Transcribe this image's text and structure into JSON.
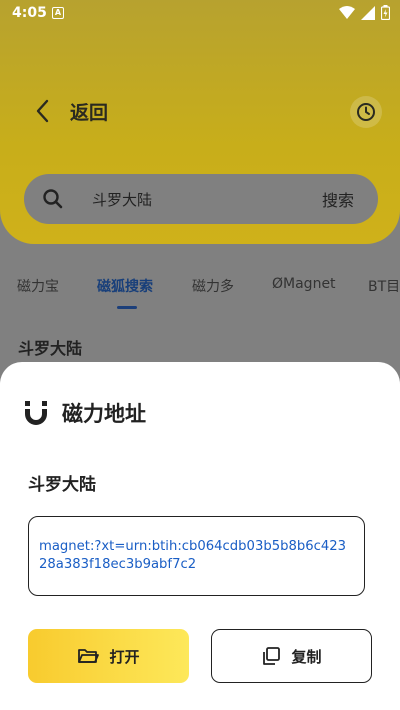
{
  "status_bar": {
    "time": "4:05",
    "notification_letter": "A"
  },
  "header": {
    "title": "返回"
  },
  "search": {
    "query": "斗罗大陆",
    "button_label": "搜索"
  },
  "tabs": [
    {
      "label": "磁力宝",
      "active": false
    },
    {
      "label": "磁狐搜索",
      "active": true
    },
    {
      "label": "磁力多",
      "active": false
    },
    {
      "label": "ØMagnet",
      "active": false
    },
    {
      "label": "BT目",
      "active": false
    }
  ],
  "result": {
    "title": "斗罗大陆"
  },
  "sheet": {
    "title": "磁力地址",
    "name": "斗罗大陆",
    "magnet": "magnet:?xt=urn:btih:cb064cdb03b5b8b6c42328a383f18ec3b9abf7c2",
    "open_label": "打开",
    "copy_label": "复制"
  },
  "colors": {
    "accent_yellow": "#f8cb2e",
    "link_blue": "#1a5ec5",
    "active_tab": "#183f7a"
  }
}
